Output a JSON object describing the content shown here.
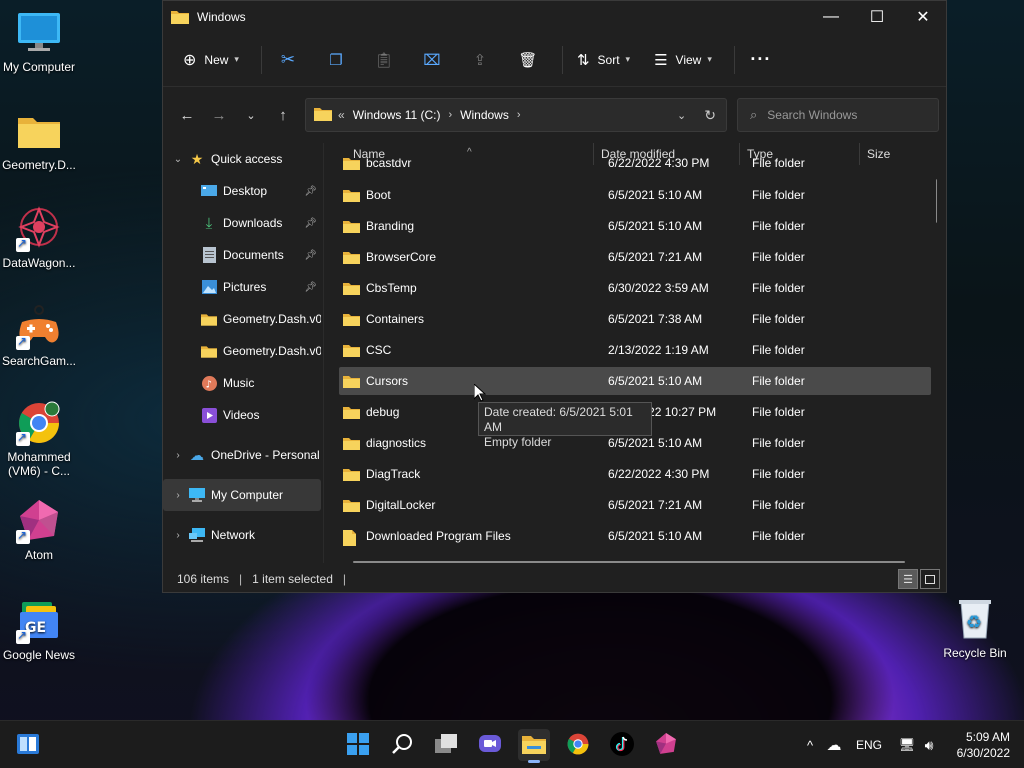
{
  "desktop": {
    "icons": [
      {
        "label": "My Computer"
      },
      {
        "label": "Geometry.D..."
      },
      {
        "label": "DataWagon..."
      },
      {
        "label": "SearchGam..."
      },
      {
        "label": "Mohammed (VM6) - C..."
      },
      {
        "label": "Atom"
      },
      {
        "label": "Google News"
      },
      {
        "label": "Recycle Bin"
      }
    ]
  },
  "window": {
    "title": "Windows",
    "toolbar": {
      "new_label": "New",
      "sort_label": "Sort",
      "view_label": "View"
    },
    "address": {
      "root_chevron": "«",
      "drive": "Windows 11 (C:)",
      "folder": "Windows"
    },
    "search": {
      "placeholder": "Search Windows"
    },
    "sidebar": {
      "quick_access": "Quick access",
      "items": [
        {
          "label": "Desktop"
        },
        {
          "label": "Downloads"
        },
        {
          "label": "Documents"
        },
        {
          "label": "Pictures"
        },
        {
          "label": "Geometry.Dash.v0"
        },
        {
          "label": "Geometry.Dash.v0"
        },
        {
          "label": "Music"
        },
        {
          "label": "Videos"
        }
      ],
      "onedrive": "OneDrive - Personal",
      "my_computer": "My Computer",
      "network": "Network"
    },
    "columns": {
      "name": "Name",
      "date": "Date modified",
      "type": "Type",
      "size": "Size"
    },
    "files": [
      {
        "name": "bcastdvr",
        "date": "6/22/2022 4:30 PM",
        "type": "File folder"
      },
      {
        "name": "Boot",
        "date": "6/5/2021 5:10 AM",
        "type": "File folder"
      },
      {
        "name": "Branding",
        "date": "6/5/2021 5:10 AM",
        "type": "File folder"
      },
      {
        "name": "BrowserCore",
        "date": "6/5/2021 7:21 AM",
        "type": "File folder"
      },
      {
        "name": "CbsTemp",
        "date": "6/30/2022 3:59 AM",
        "type": "File folder"
      },
      {
        "name": "Containers",
        "date": "6/5/2021 7:38 AM",
        "type": "File folder"
      },
      {
        "name": "CSC",
        "date": "2/13/2022 1:19 AM",
        "type": "File folder"
      },
      {
        "name": "Cursors",
        "date": "6/5/2021 5:10 AM",
        "type": "File folder"
      },
      {
        "name": "debug",
        "date": "6/30/2022 10:27 PM",
        "type": "File folder"
      },
      {
        "name": "diagnostics",
        "date": "6/5/2021 5:10 AM",
        "type": "File folder"
      },
      {
        "name": "DiagTrack",
        "date": "6/22/2022 4:30 PM",
        "type": "File folder"
      },
      {
        "name": "DigitalLocker",
        "date": "6/5/2021 7:21 AM",
        "type": "File folder"
      },
      {
        "name": "Downloaded Program Files",
        "date": "6/5/2021 5:10 AM",
        "type": "File folder"
      }
    ],
    "tooltip": {
      "line1": "Date created: 6/5/2021 5:01 AM",
      "line2": "Empty folder"
    },
    "status": {
      "items": "106 items",
      "selected": "1 item selected"
    }
  },
  "taskbar": {
    "lang": "ENG",
    "time": "5:09 AM",
    "date": "6/30/2022"
  },
  "colors": {
    "accent": "#8ab4f8",
    "folder": "#f7c948",
    "selected_row": "#4a4a4a"
  }
}
